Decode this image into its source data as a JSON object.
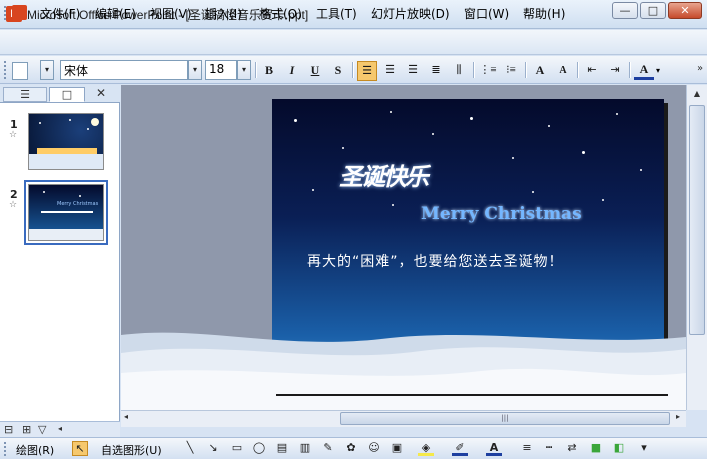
{
  "window": {
    "app_icon_label": "P",
    "title": "Microsoft Office PowerPoint - [圣诞搞怪音乐贺卡.ppt]",
    "minimize_glyph": "—",
    "maximize_glyph": "□",
    "close_glyph": "✕"
  },
  "menu": {
    "items": [
      "文件(F)",
      "编辑(E)",
      "视图(V)",
      "插入(I)",
      "格式(O)",
      "工具(T)",
      "幻灯片放映(D)",
      "窗口(W)",
      "帮助(H)"
    ]
  },
  "toolbar": {
    "font_name": "宋体",
    "font_size": "18",
    "bold": "B",
    "italic": "I",
    "underline": "U",
    "shadow": "S",
    "grow_font": "A",
    "shrink_font": "A",
    "font_color": "A"
  },
  "left_panel": {
    "tab_outline_icon": "☰",
    "tab_slides_icon": "□",
    "close": "✕",
    "slides": [
      {
        "number": "1",
        "star": "☆"
      },
      {
        "number": "2",
        "star": "☆"
      }
    ],
    "thumb2_caption": "Merry Christmas"
  },
  "slide": {
    "greeting_art": "圣诞快乐",
    "heading": "Merry Christmas",
    "subtitle": "再大的“困难”，也要给您送去圣诞物！",
    "colors": {
      "sky_top": "#040a2b",
      "sky_bottom": "#3d8fd2",
      "snow": "#e8eef6"
    }
  },
  "drawing_toolbar": {
    "draw_menu": "绘图(R)",
    "autoshapes_menu": "自选图形(U)"
  },
  "icons": [
    "app-icon",
    "new-doc-icon",
    "align-left-icon",
    "select-arrow-icon",
    "line-icon",
    "arrow-icon",
    "rectangle-icon",
    "oval-icon",
    "textbox-icon",
    "fill-color-icon",
    "line-color-icon",
    "font-color-icon"
  ]
}
